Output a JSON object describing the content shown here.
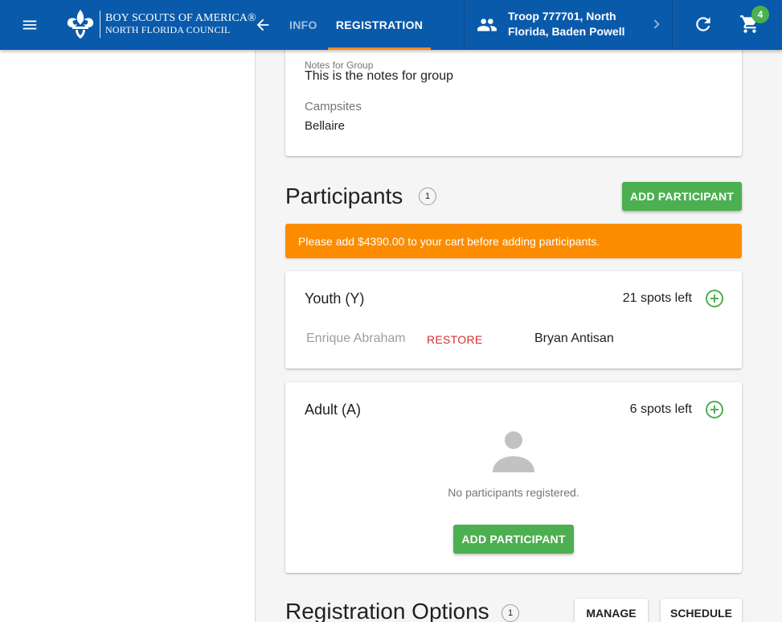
{
  "appbar": {
    "logo_line1": "BOY SCOUTS OF AMERICA®",
    "logo_line2": "NORTH FLORIDA COUNCIL",
    "tabs": [
      {
        "label": "INFO"
      },
      {
        "label": "REGISTRATION"
      }
    ],
    "troop_line1": "Troop 777701, North",
    "troop_line2": "Florida, Baden Powell",
    "cart_count": "4",
    "colors": {
      "bar": "#0a5aab",
      "tab_indicator": "#f58a1f",
      "badge": "#4caf50"
    }
  },
  "notes": {
    "notes_label": "Notes for Group",
    "notes_value": "This is the notes for group",
    "campsites_label": "Campsites",
    "campsites_value": "Bellaire"
  },
  "participants": {
    "title": "Participants",
    "count": "1",
    "add_label": "ADD PARTICIPANT",
    "alert": "Please add $4390.00 to your cart before adding participants.",
    "youth": {
      "title": "Youth (Y)",
      "spots": "21 spots left",
      "removed_name": "Enrique Abraham",
      "restore_label": "RESTORE",
      "name": "Bryan Antisan"
    },
    "adult": {
      "title": "Adult (A)",
      "spots": "6 spots left",
      "empty_text": "No participants registered.",
      "add_label": "ADD PARTICIPANT"
    }
  },
  "registration_options": {
    "title": "Registration Options",
    "count": "1",
    "manage_label": "MANAGE",
    "schedule_label": "SCHEDULE"
  }
}
